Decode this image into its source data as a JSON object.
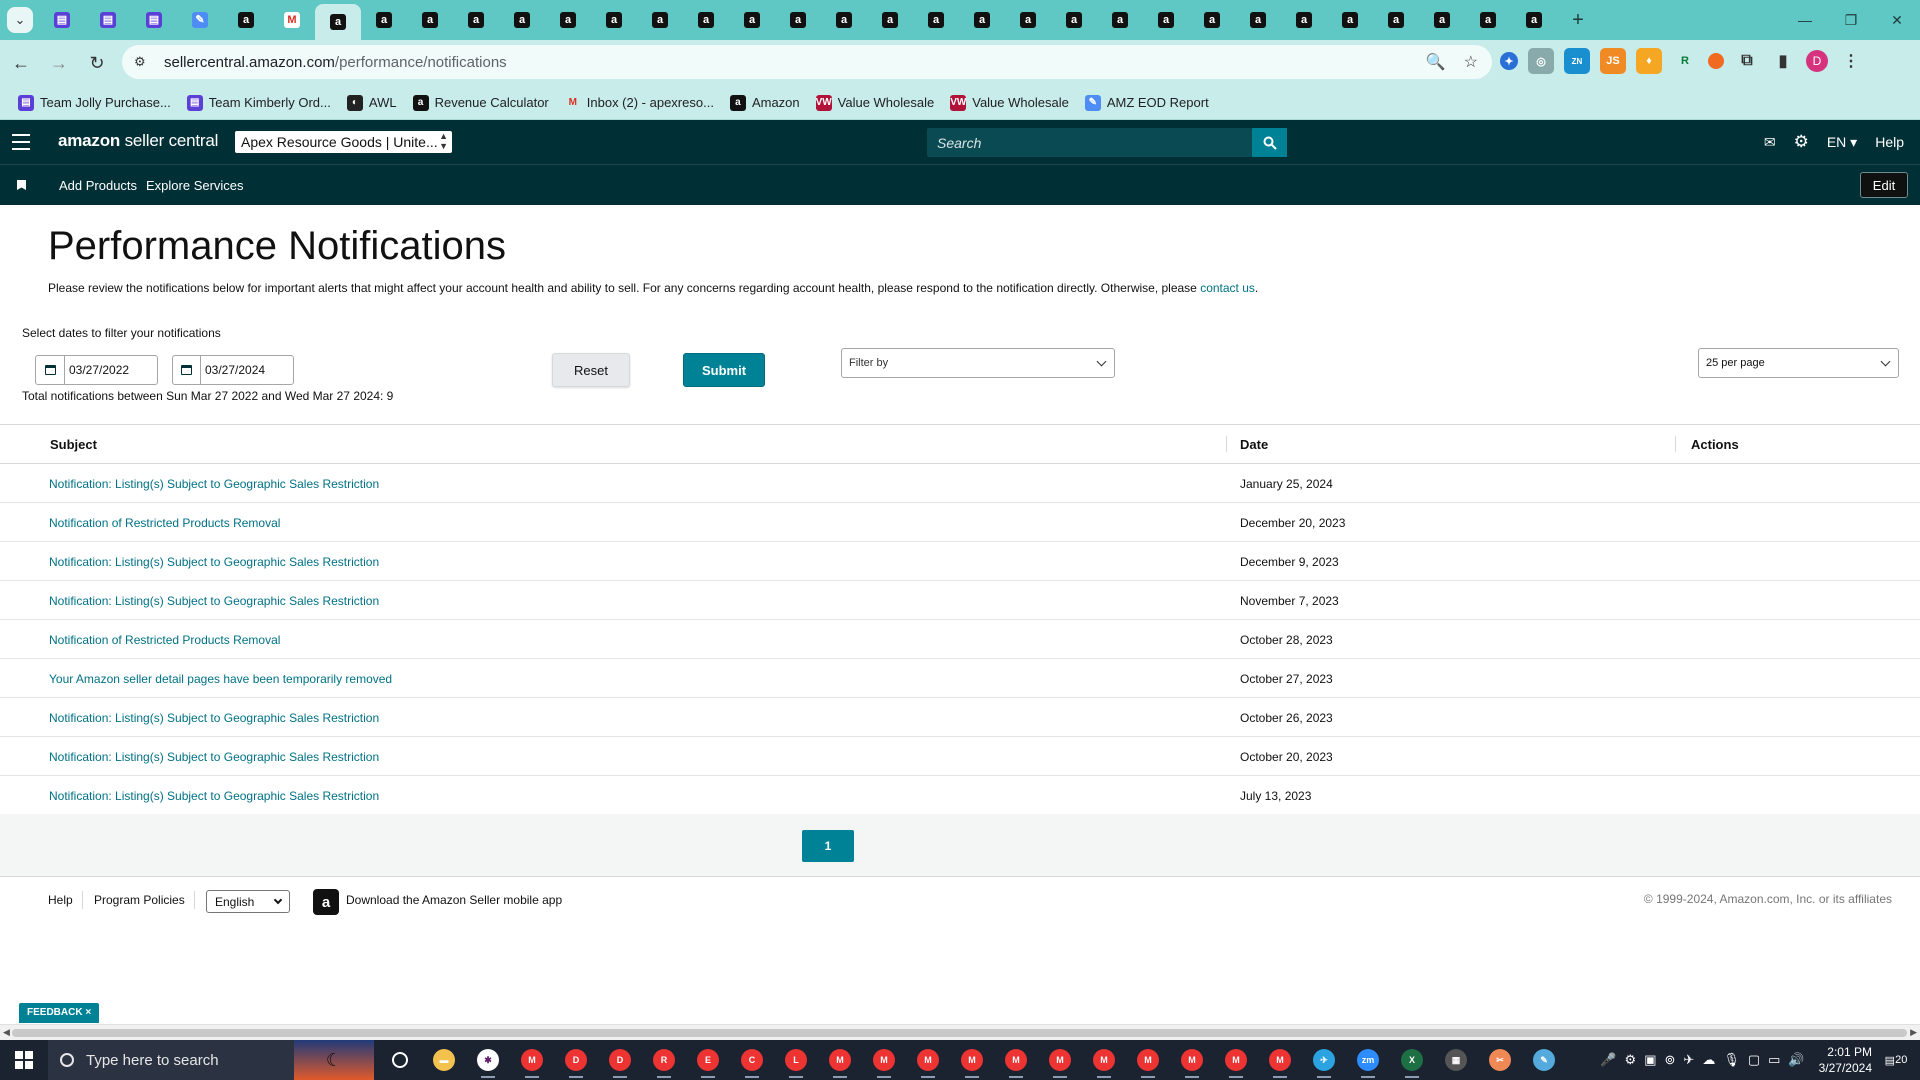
{
  "browser": {
    "tab_count_icons": [
      "sheet",
      "sheet",
      "sheet",
      "tool",
      "amz",
      "gm",
      "amz",
      "amz",
      "amz",
      "amz",
      "amz",
      "amz",
      "amz",
      "amz",
      "amz",
      "amz",
      "amz",
      "amz",
      "amz",
      "amz",
      "amz",
      "amz",
      "amz",
      "amz",
      "amz",
      "amz",
      "amz",
      "amz",
      "amz",
      "amz",
      "amz",
      "amz",
      "amz",
      "drv"
    ],
    "url_host": "sellercentral.amazon.com",
    "url_path": "/performance/notifications",
    "bookmarks": [
      {
        "label": "Team Jolly Purchase...",
        "icon": "sheet",
        "color": "#5b3fd6"
      },
      {
        "label": "Team Kimberly Ord...",
        "icon": "sheet",
        "color": "#5b3fd6"
      },
      {
        "label": "AWL",
        "icon": "awl",
        "color": "#222222"
      },
      {
        "label": "Revenue Calculator",
        "icon": "a",
        "color": "#111111"
      },
      {
        "label": "Inbox (2) - apexreso...",
        "icon": "gmail",
        "color": "#d93025"
      },
      {
        "label": "Amazon",
        "icon": "a",
        "color": "#111111"
      },
      {
        "label": "Value Wholesale",
        "icon": "VW",
        "color": "#b1123a"
      },
      {
        "label": "Value Wholesale",
        "icon": "VW",
        "color": "#b1123a"
      },
      {
        "label": "AMZ EOD Report",
        "icon": "tool",
        "color": "#4e8df5"
      }
    ],
    "profile_initial": "D"
  },
  "header": {
    "logo_brand": "amazon",
    "logo_rest": " seller central",
    "account": "Apex Resource Goods | Unite...",
    "search_placeholder": "Search",
    "lang": "EN",
    "help": "Help"
  },
  "nav": {
    "links": [
      "Add Products",
      "Explore Services"
    ],
    "edit": "Edit"
  },
  "page": {
    "title": "Performance Notifications",
    "intro": "Please review the notifications below for important alerts that might affect your account health and ability to sell. For any concerns regarding account health, please respond to the notification directly. Otherwise, please ",
    "intro_link": "contact us",
    "intro_end": ".",
    "filter_label": "Select dates to filter your notifications",
    "date_from": "03/27/2022",
    "date_to": "03/27/2024",
    "total": "Total notifications between Sun Mar 27 2022 and Wed Mar 27 2024: 9",
    "reset": "Reset",
    "submit": "Submit",
    "filter_by": "Filter by",
    "per_page": "25 per page"
  },
  "table": {
    "headers": {
      "subject": "Subject",
      "date": "Date",
      "actions": "Actions"
    },
    "rows": [
      {
        "subject": "Notification: Listing(s) Subject to Geographic Sales Restriction",
        "date": "January 25, 2024"
      },
      {
        "subject": "Notification of Restricted Products Removal",
        "date": "December 20, 2023"
      },
      {
        "subject": "Notification: Listing(s) Subject to Geographic Sales Restriction",
        "date": "December 9, 2023"
      },
      {
        "subject": "Notification: Listing(s) Subject to Geographic Sales Restriction",
        "date": "November 7, 2023"
      },
      {
        "subject": "Notification of Restricted Products Removal",
        "date": "October 28, 2023"
      },
      {
        "subject": "Your Amazon seller detail pages have been temporarily removed",
        "date": "October 27, 2023"
      },
      {
        "subject": "Notification: Listing(s) Subject to Geographic Sales Restriction",
        "date": "October 26, 2023"
      },
      {
        "subject": "Notification: Listing(s) Subject to Geographic Sales Restriction",
        "date": "October 20, 2023"
      },
      {
        "subject": "Notification: Listing(s) Subject to Geographic Sales Restriction",
        "date": "July 13, 2023"
      }
    ]
  },
  "pagination": {
    "current": "1"
  },
  "footer": {
    "help": "Help",
    "policies": "Program Policies",
    "language": "English",
    "app_text": "Download the Amazon Seller mobile app",
    "copyright": "© 1999-2024, Amazon.com, Inc. or its affiliates"
  },
  "feedback": "FEEDBACK ×",
  "taskbar": {
    "search_placeholder": "Type here to search",
    "time": "2:01 PM",
    "date": "3/27/2024",
    "notifications": "20"
  },
  "colors": {
    "teal_header": "#002f36",
    "accent": "#008296",
    "link": "#007185",
    "chrome_tabstrip": "#5fc8c4"
  }
}
